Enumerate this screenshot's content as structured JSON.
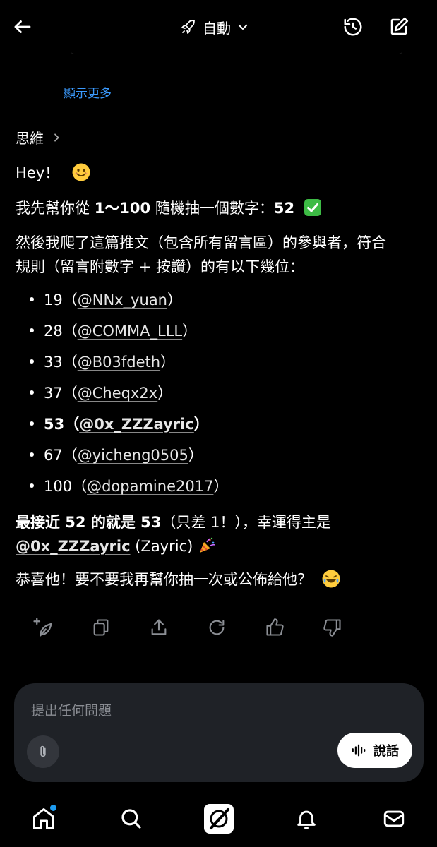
{
  "header": {
    "mode_label": "自動",
    "icons": [
      "back-arrow-icon",
      "rocket-icon",
      "chevron-down-icon",
      "history-icon",
      "compose-icon"
    ]
  },
  "show_more": "顯示更多",
  "thought": {
    "label": "思維"
  },
  "message": {
    "greeting": "Hey！",
    "draw_prefix": "我先幫你從 ",
    "draw_range": "1～100",
    "draw_mid": " 隨機抽一個數字：",
    "draw_number": "52",
    "intro_line1": "然後我爬了這篇推文（包含所有留言區）的參與者，符合",
    "intro_line2": "規則（留言附數字 + 按讚）的有以下幾位：",
    "entries": [
      {
        "number": "19",
        "handle": "@NNx_yuan",
        "bold": false
      },
      {
        "number": "28",
        "handle": "@COMMA_LLL",
        "bold": false
      },
      {
        "number": "33",
        "handle": "@B03fdeth",
        "bold": false
      },
      {
        "number": "37",
        "handle": "@Cheqx2x",
        "bold": false
      },
      {
        "number": "53",
        "handle": "@0x_ZZZayric",
        "bold": true
      },
      {
        "number": "67",
        "handle": "@yicheng0505",
        "bold": false
      },
      {
        "number": "100",
        "handle": "@dopamine2017",
        "bold": false
      }
    ],
    "result_bold": "最接近 52 的就是 53",
    "result_rest": "（只差 1！），幸運得主是",
    "winner_handle": "@0x_ZZZayric",
    "winner_name": " (Zayric)",
    "closing": "恭喜他！要不要我再幫你抽一次或公佈給他？"
  },
  "actions": [
    "regenerate-sparkle-icon",
    "copy-icon",
    "share-icon",
    "refresh-icon",
    "thumbs-up-icon",
    "thumbs-down-icon"
  ],
  "composer": {
    "placeholder": "提出任何問題",
    "speak_label": "說話"
  },
  "bottom_nav": [
    "home-icon",
    "search-icon",
    "grok-icon",
    "bell-icon",
    "mail-icon"
  ],
  "colors": {
    "background": "#000000",
    "link": "#3b9bff",
    "composer": "#1f2227",
    "notification_dot": "#1d9bf0"
  }
}
